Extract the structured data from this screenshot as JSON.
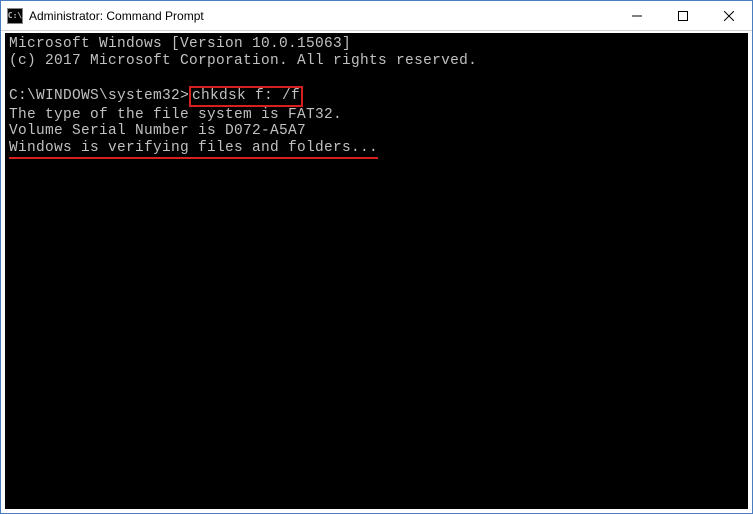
{
  "titlebar": {
    "icon_label": "C:\\",
    "title": "Administrator: Command Prompt"
  },
  "terminal": {
    "line1": "Microsoft Windows [Version 10.0.15063]",
    "line2": "(c) 2017 Microsoft Corporation. All rights reserved.",
    "prompt": "C:\\WINDOWS\\system32>",
    "command": "chkdsk f: /f",
    "out1": "The type of the file system is FAT32.",
    "out2": "Volume Serial Number is D072-A5A7",
    "out3": "Windows is verifying files and folders..."
  }
}
